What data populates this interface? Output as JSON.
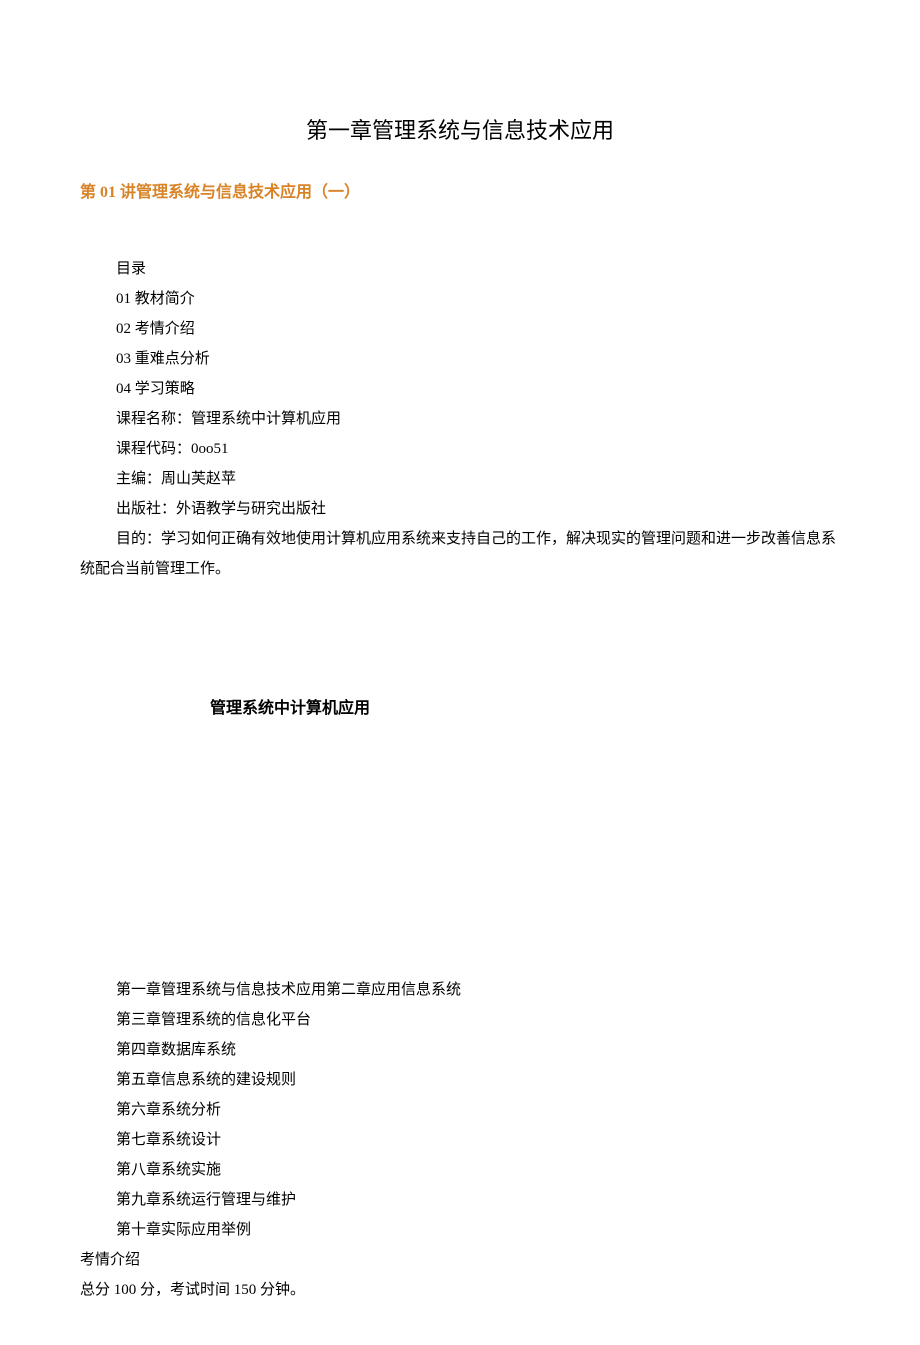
{
  "chapterTitle": "第一章管理系统与信息技术应用",
  "lectureTitle": "第 01 讲管理系统与信息技术应用（一）",
  "tocLabel": "目录",
  "toc": [
    "01 教材简介",
    "02 考情介绍",
    "03 重难点分析",
    "04 学习策略"
  ],
  "courseNameLabel": "课程名称：管理系统中计算机应用",
  "courseCodeLabel": "课程代码：0oo51",
  "editorLabel": "主编：周山芙赵苹",
  "publisherLabel": "出版社：外语教学与研究出版社",
  "objective": "目的：学习如何正确有效地使用计算机应用系统来支持自己的工作，解决现实的管理问题和进一步改善信息系统配合当前管理工作。",
  "courseAppTitle": "管理系统中计算机应用",
  "chapterRow1": "第一章管理系统与信息技术应用第二章应用信息系统",
  "chapters": [
    "第三章管理系统的信息化平台",
    "第四章数据库系统",
    "第五章信息系统的建设规则",
    "第六章系统分析",
    "第七章系统设计",
    "第八章系统实施",
    "第九章系统运行管理与维护",
    "第十章实际应用举例"
  ],
  "examIntroLabel": "考情介绍",
  "examSummary": "总分 100 分，考试时间 150 分钟。"
}
